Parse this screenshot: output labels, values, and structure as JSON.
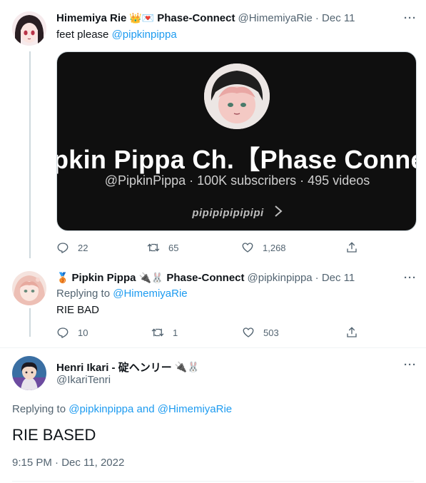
{
  "tweet1": {
    "author_name": "Himemiya Rie",
    "author_emoji": "👑💌",
    "author_suffix": "Phase-Connect",
    "handle": "@HimemiyaRie",
    "date": "· Dec 11",
    "text_prefix": "feet please",
    "mention": "@pipkinpippa",
    "card": {
      "title": "pkin Pippa Ch.【Phase Connect",
      "subtitle": "@PipkinPippa · 100K subscribers · 495 videos",
      "footer": "pipipipipipipi"
    },
    "replies": "22",
    "retweets": "65",
    "likes": "1,268"
  },
  "tweet2": {
    "author_emoji_prefix": "🥉",
    "author_name": "Pipkin Pippa",
    "author_emoji": "🔌🐰",
    "author_suffix": "Phase-Connect",
    "handle": "@pipkinpippa",
    "date": "· Dec 11",
    "replying_label": "Replying to",
    "replying_to": "@HimemiyaRie",
    "text": "RIE BAD",
    "replies": "10",
    "retweets": "1",
    "likes": "503"
  },
  "tweet3": {
    "author_name": "Henri Ikari - 碇ヘンリー",
    "author_emoji": "🔌🐰",
    "handle": "@IkariTenri",
    "replying_label": "Replying to",
    "replying_to_1": "@pipkinpippa",
    "replying_and": "and",
    "replying_to_2": "@HimemiyaRie",
    "text": "RIE BASED",
    "timestamp": "9:15 PM · Dec 11, 2022"
  },
  "more_label": "···",
  "colors": {
    "accent": "#1d9bf0",
    "muted": "#536471",
    "text": "#0f1419",
    "thread_line": "#cfd9de",
    "card_bg": "#0f0f0f"
  },
  "icons": [
    "reply-icon",
    "retweet-icon",
    "like-icon",
    "share-icon",
    "more-icon"
  ]
}
